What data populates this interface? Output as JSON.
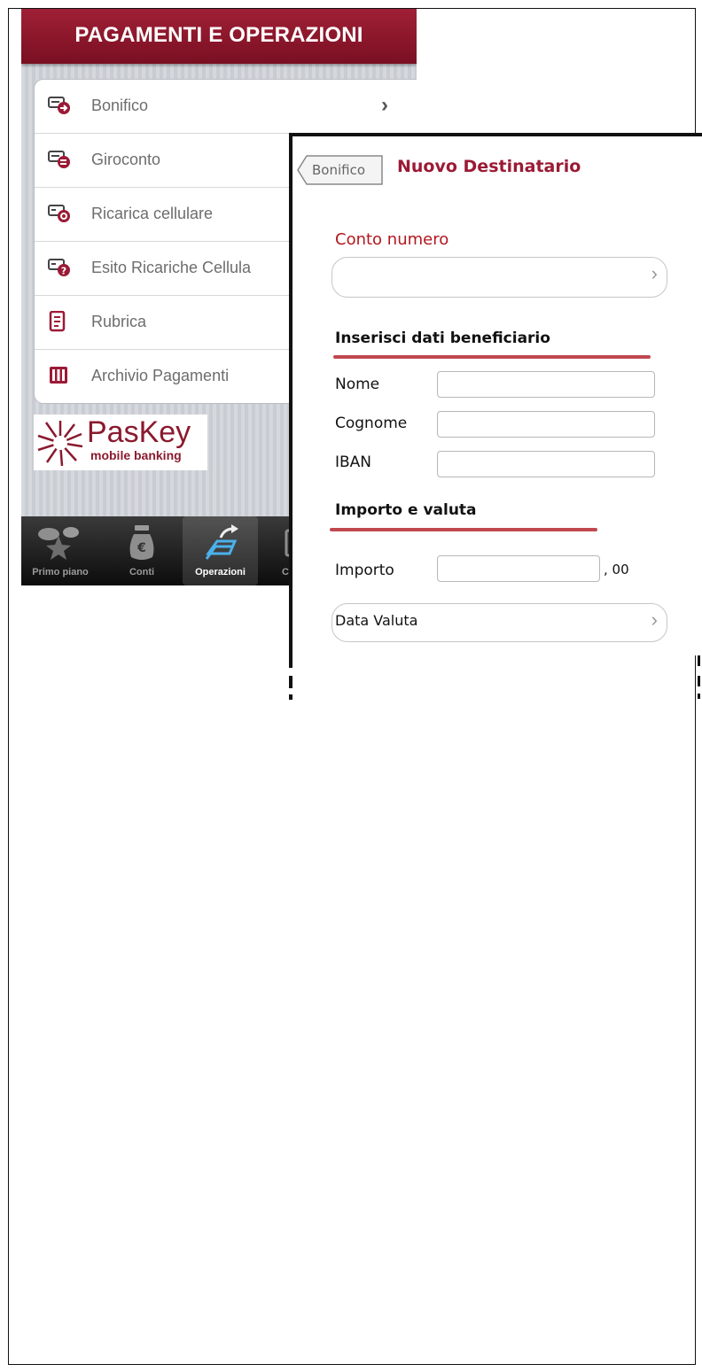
{
  "left_screen": {
    "header_title": "PAGAMENTI E OPERAZIONI",
    "menu": [
      {
        "label": "Bonifico",
        "icon": "transfer-out-icon",
        "has_chevron": true
      },
      {
        "label": "Giroconto",
        "icon": "transfer-between-icon"
      },
      {
        "label": "Ricarica cellulare",
        "icon": "mobile-topup-icon"
      },
      {
        "label": "Esito Ricariche Cellula",
        "icon": "topup-status-icon"
      },
      {
        "label": "Rubrica",
        "icon": "address-book-icon"
      },
      {
        "label": "Archivio Pagamenti",
        "icon": "payment-archive-icon"
      }
    ],
    "logo": {
      "text": "PasKey",
      "subtitle": "mobile banking"
    },
    "tabbar": [
      {
        "label": "Primo piano",
        "icon": "star-balloons-icon"
      },
      {
        "label": "Conti",
        "icon": "money-bag-icon"
      },
      {
        "label": "Operazioni",
        "icon": "operations-icon",
        "active": true
      },
      {
        "label": "C",
        "icon": "calendar-icon"
      }
    ]
  },
  "form_panel": {
    "back_button": "Bonifico",
    "title": "Nuovo Destinatario",
    "conto_label": "Conto  numero",
    "conto_value": "",
    "beneficiary_heading": "Inserisci dati  beneficiario",
    "fields": [
      {
        "label": "Nome",
        "value": ""
      },
      {
        "label": "Cognome",
        "value": ""
      },
      {
        "label": "IBAN",
        "value": ""
      }
    ],
    "amount_heading": "Importo  e valuta",
    "importo_label": "Importo",
    "importo_value": "",
    "cents_suffix": ", 00",
    "data_valuta_label": "Data Valuta"
  },
  "colors": {
    "brand": "#8a1a2e",
    "accent_red": "#b3171f",
    "underline": "#c0484f"
  }
}
